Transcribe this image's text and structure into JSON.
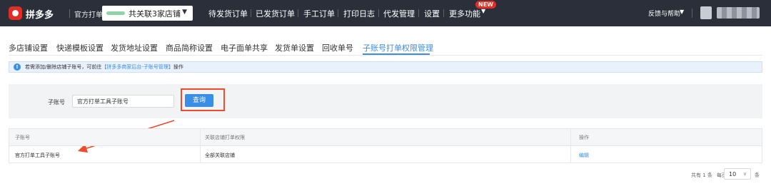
{
  "topbar": {
    "brand": "拼多多",
    "brand_sub": "官方打单",
    "shop_selector": {
      "value": "共关联3家店铺",
      "icon": "chevron-down-icon"
    },
    "nav": [
      {
        "label": "待发货订单"
      },
      {
        "label": "已发货订单"
      },
      {
        "label": "手工订单"
      },
      {
        "label": "打印日志"
      },
      {
        "label": "代发管理"
      },
      {
        "label": "设置"
      },
      {
        "label": "更多功能",
        "badge": "NEW"
      }
    ],
    "help": "反馈与帮助"
  },
  "tabs": [
    {
      "label": "多店铺设置"
    },
    {
      "label": "快递模板设置"
    },
    {
      "label": "发货地址设置"
    },
    {
      "label": "商品简称设置"
    },
    {
      "label": "电子面单共享"
    },
    {
      "label": "发货单设置"
    },
    {
      "label": "回收单号"
    },
    {
      "label": "子账号打单权限管理",
      "active": true
    }
  ],
  "notice": {
    "icon": "info-icon",
    "text_before": "若需添加/删除店铺子账号，可前往",
    "link": "【拼多多商家后台-子账号管理】",
    "text_after": "操作"
  },
  "search": {
    "label": "子账号",
    "input_value": "官方打单工具子账号",
    "button": "查询"
  },
  "table": {
    "headers": [
      "子账号",
      "关联店铺打单权限",
      "操作"
    ],
    "rows": [
      {
        "account": "官方打单工具子账号",
        "permission": "全部关联店铺",
        "action": "编辑"
      }
    ]
  },
  "pagination": {
    "total_text": "共有 1 条",
    "per_page_label": "每页",
    "page_size": "10",
    "unit": "条"
  },
  "colors": {
    "topbar_bg": "#2b2f3a",
    "accent": "#3a8ee6",
    "brand_red": "#e02e24",
    "annotation": "#f04b2a"
  }
}
